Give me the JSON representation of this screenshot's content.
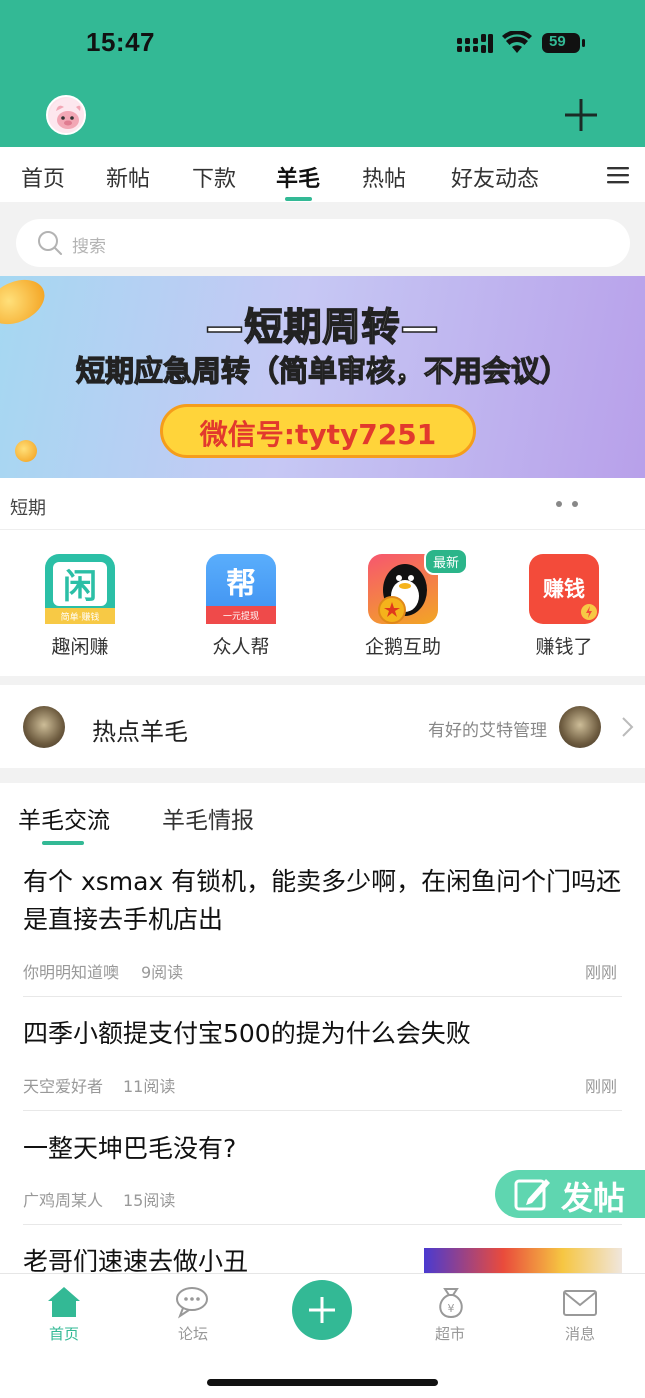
{
  "status_bar": {
    "time": "15:47",
    "battery": "59"
  },
  "tabs": [
    "首页",
    "新帖",
    "下款",
    "羊毛",
    "热帖",
    "好友动态"
  ],
  "active_tab": "羊毛",
  "search": {
    "placeholder": "搜索"
  },
  "banner": {
    "title": "—短期周转—",
    "subtitle": "短期应急周转（简单审核，不用会议）",
    "wechat": "微信号:tyty7251"
  },
  "section": {
    "label": "短期"
  },
  "apps": [
    {
      "name": "趣闲赚",
      "icon": "xian-app-icon",
      "color": "#2bbfa6",
      "glyph": "闲",
      "tag": "简单·赚钱"
    },
    {
      "name": "众人帮",
      "icon": "bang-app-icon",
      "color": "#3d8ff0",
      "glyph": "帮",
      "tag": "一元提现"
    },
    {
      "name": "企鹅互助",
      "icon": "penguin-app-icon",
      "color": "#f2a624",
      "glyph": "",
      "tag": ""
    },
    {
      "name": "赚钱了",
      "icon": "zhuanqian-app-icon",
      "color": "#f34b3a",
      "glyph": "赚钱",
      "tag": ""
    }
  ],
  "new_badge": "最新",
  "hot": {
    "title": "热点羊毛",
    "manager": "有好的艾特管理"
  },
  "feed_tabs": [
    "羊毛交流",
    "羊毛情报"
  ],
  "posts": [
    {
      "title": "有个 xsmax 有锁机，能卖多少啊，在闲鱼问个门吗还是直接去手机店出",
      "author": "你明明知道噢",
      "reads": "9阅读",
      "time": "刚刚"
    },
    {
      "title": "四季小额提支付宝500的提为什么会失败",
      "author": "天空爱好者",
      "reads": "11阅读",
      "time": "刚刚"
    },
    {
      "title": "一整天坤巴毛没有?",
      "author": "广鸡周某人",
      "reads": "15阅读",
      "time": ""
    },
    {
      "title": "老哥们速速去做小丑",
      "author": "",
      "reads": "",
      "time": ""
    }
  ],
  "fab": {
    "label": "发帖"
  },
  "bottom_nav": [
    {
      "label": "首页",
      "icon": "home-icon"
    },
    {
      "label": "论坛",
      "icon": "forum-icon"
    },
    {
      "label": "超市",
      "icon": "market-icon"
    },
    {
      "label": "消息",
      "icon": "message-icon"
    }
  ],
  "colors": {
    "brand": "#33b995",
    "brand_light": "#5fd6b0"
  }
}
